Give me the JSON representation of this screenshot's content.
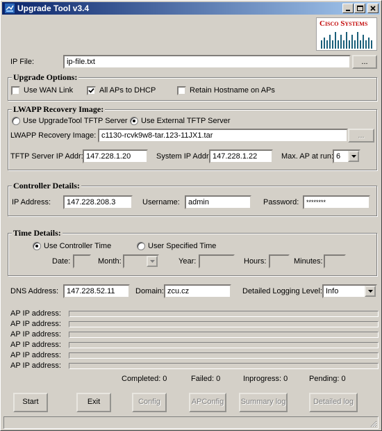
{
  "window": {
    "title": "Upgrade Tool v3.4",
    "logo_text": "Cisco Systems"
  },
  "ip_file": {
    "label": "IP File:",
    "value": "ip-file.txt",
    "browse": "..."
  },
  "upgrade_options": {
    "title": "Upgrade Options:",
    "use_wan_link": {
      "label": "Use WAN Link",
      "checked": false
    },
    "all_aps_dhcp": {
      "label": "All APs to DHCP",
      "checked": true
    },
    "retain_hostname": {
      "label": "Retain Hostname on APs",
      "checked": false
    }
  },
  "lwapp": {
    "title": "LWAPP Recovery Image:",
    "radio_upgradetool": {
      "label": "Use UpgradeTool TFTP Server",
      "selected": false
    },
    "radio_external": {
      "label": "Use External TFTP Server",
      "selected": true
    },
    "image_label": "LWAPP Recovery Image:",
    "image_value": "c1130-rcvk9w8-tar.123-11JX1.tar",
    "browse": "...",
    "tftp_label": "TFTP Server IP Addr:",
    "tftp_value": "147.228.1.20",
    "system_ip_label": "System IP Addr:",
    "system_ip_value": "147.228.1.22",
    "max_ap_label": "Max. AP at run:",
    "max_ap_value": "6"
  },
  "controller": {
    "title": "Controller Details:",
    "ip_label": "IP Address:",
    "ip_value": "147.228.208.3",
    "username_label": "Username:",
    "username_value": "admin",
    "password_label": "Password:",
    "password_value": "********"
  },
  "time": {
    "title": "Time Details:",
    "radio_controller": {
      "label": "Use Controller Time",
      "selected": true
    },
    "radio_user": {
      "label": "User Specified Time",
      "selected": false
    },
    "date_label": "Date:",
    "month_label": "Month:",
    "year_label": "Year:",
    "hours_label": "Hours:",
    "minutes_label": "Minutes:"
  },
  "dns": {
    "label": "DNS Address:",
    "value": "147.228.52.11",
    "domain_label": "Domain:",
    "domain_value": "zcu.cz",
    "logging_label": "Detailed Logging Level:",
    "logging_value": "Info"
  },
  "ap_rows": [
    {
      "label": "AP IP address:",
      "progress": 0
    },
    {
      "label": "AP IP address:",
      "progress": 0
    },
    {
      "label": "AP IP address:",
      "progress": 0
    },
    {
      "label": "AP IP address:",
      "progress": 0
    },
    {
      "label": "AP IP address:",
      "progress": 0
    },
    {
      "label": "AP IP address:",
      "progress": 0
    }
  ],
  "counts": {
    "completed": "Completed: 0",
    "failed": "Failed: 0",
    "inprogress": "Inprogress: 0",
    "pending": "Pending: 0"
  },
  "buttons": {
    "start": "Start",
    "exit": "Exit",
    "config": "Config",
    "apconfig": "APConfig",
    "summary_log": "Summary log",
    "detailed_log": "Detailed log"
  },
  "colors": {
    "titlebar_start": "#0a246a",
    "titlebar_end": "#a6caf0",
    "window_bg": "#d4d0c8",
    "logo_text": "#c00000",
    "logo_bars": "#1a5f7a"
  },
  "icons": [
    "app-icon",
    "minimize-icon",
    "maximize-icon",
    "close-icon",
    "checkmark-icon",
    "dropdown-arrow-icon"
  ]
}
